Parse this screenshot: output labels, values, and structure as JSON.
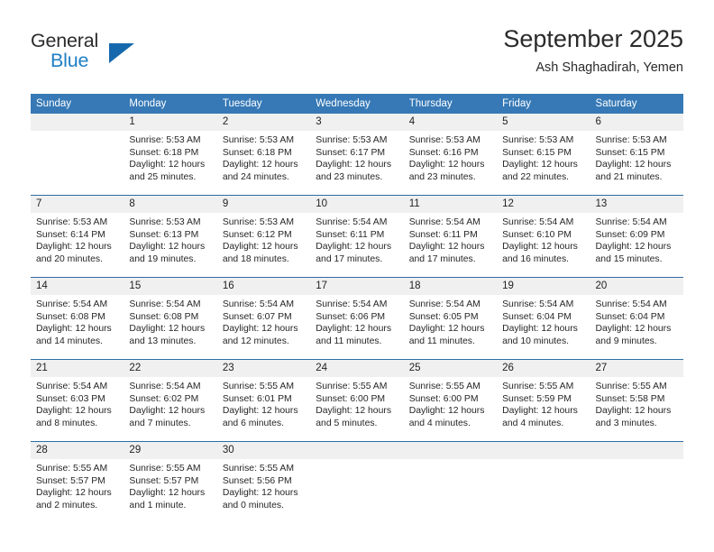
{
  "brand": {
    "word_one": "General",
    "word_two": "Blue",
    "triangle_icon": "triangle-icon",
    "accent_color": "#1668ad"
  },
  "header": {
    "title": "September 2025",
    "subtitle": "Ash Shaghadirah, Yemen"
  },
  "theme": {
    "header_row_bg": "#3679b6",
    "daynum_bg": "#f0f0f0",
    "week_separator": "#2e6da4",
    "text": "#262626"
  },
  "calendar": {
    "weekday_headers": [
      "Sunday",
      "Monday",
      "Tuesday",
      "Wednesday",
      "Thursday",
      "Friday",
      "Saturday"
    ],
    "weeks": [
      [
        {
          "day": "",
          "lines": []
        },
        {
          "day": "1",
          "lines": [
            "Sunrise: 5:53 AM",
            "Sunset: 6:18 PM",
            "Daylight: 12 hours",
            "and 25 minutes."
          ]
        },
        {
          "day": "2",
          "lines": [
            "Sunrise: 5:53 AM",
            "Sunset: 6:18 PM",
            "Daylight: 12 hours",
            "and 24 minutes."
          ]
        },
        {
          "day": "3",
          "lines": [
            "Sunrise: 5:53 AM",
            "Sunset: 6:17 PM",
            "Daylight: 12 hours",
            "and 23 minutes."
          ]
        },
        {
          "day": "4",
          "lines": [
            "Sunrise: 5:53 AM",
            "Sunset: 6:16 PM",
            "Daylight: 12 hours",
            "and 23 minutes."
          ]
        },
        {
          "day": "5",
          "lines": [
            "Sunrise: 5:53 AM",
            "Sunset: 6:15 PM",
            "Daylight: 12 hours",
            "and 22 minutes."
          ]
        },
        {
          "day": "6",
          "lines": [
            "Sunrise: 5:53 AM",
            "Sunset: 6:15 PM",
            "Daylight: 12 hours",
            "and 21 minutes."
          ]
        }
      ],
      [
        {
          "day": "7",
          "lines": [
            "Sunrise: 5:53 AM",
            "Sunset: 6:14 PM",
            "Daylight: 12 hours",
            "and 20 minutes."
          ]
        },
        {
          "day": "8",
          "lines": [
            "Sunrise: 5:53 AM",
            "Sunset: 6:13 PM",
            "Daylight: 12 hours",
            "and 19 minutes."
          ]
        },
        {
          "day": "9",
          "lines": [
            "Sunrise: 5:53 AM",
            "Sunset: 6:12 PM",
            "Daylight: 12 hours",
            "and 18 minutes."
          ]
        },
        {
          "day": "10",
          "lines": [
            "Sunrise: 5:54 AM",
            "Sunset: 6:11 PM",
            "Daylight: 12 hours",
            "and 17 minutes."
          ]
        },
        {
          "day": "11",
          "lines": [
            "Sunrise: 5:54 AM",
            "Sunset: 6:11 PM",
            "Daylight: 12 hours",
            "and 17 minutes."
          ]
        },
        {
          "day": "12",
          "lines": [
            "Sunrise: 5:54 AM",
            "Sunset: 6:10 PM",
            "Daylight: 12 hours",
            "and 16 minutes."
          ]
        },
        {
          "day": "13",
          "lines": [
            "Sunrise: 5:54 AM",
            "Sunset: 6:09 PM",
            "Daylight: 12 hours",
            "and 15 minutes."
          ]
        }
      ],
      [
        {
          "day": "14",
          "lines": [
            "Sunrise: 5:54 AM",
            "Sunset: 6:08 PM",
            "Daylight: 12 hours",
            "and 14 minutes."
          ]
        },
        {
          "day": "15",
          "lines": [
            "Sunrise: 5:54 AM",
            "Sunset: 6:08 PM",
            "Daylight: 12 hours",
            "and 13 minutes."
          ]
        },
        {
          "day": "16",
          "lines": [
            "Sunrise: 5:54 AM",
            "Sunset: 6:07 PM",
            "Daylight: 12 hours",
            "and 12 minutes."
          ]
        },
        {
          "day": "17",
          "lines": [
            "Sunrise: 5:54 AM",
            "Sunset: 6:06 PM",
            "Daylight: 12 hours",
            "and 11 minutes."
          ]
        },
        {
          "day": "18",
          "lines": [
            "Sunrise: 5:54 AM",
            "Sunset: 6:05 PM",
            "Daylight: 12 hours",
            "and 11 minutes."
          ]
        },
        {
          "day": "19",
          "lines": [
            "Sunrise: 5:54 AM",
            "Sunset: 6:04 PM",
            "Daylight: 12 hours",
            "and 10 minutes."
          ]
        },
        {
          "day": "20",
          "lines": [
            "Sunrise: 5:54 AM",
            "Sunset: 6:04 PM",
            "Daylight: 12 hours",
            "and 9 minutes."
          ]
        }
      ],
      [
        {
          "day": "21",
          "lines": [
            "Sunrise: 5:54 AM",
            "Sunset: 6:03 PM",
            "Daylight: 12 hours",
            "and 8 minutes."
          ]
        },
        {
          "day": "22",
          "lines": [
            "Sunrise: 5:54 AM",
            "Sunset: 6:02 PM",
            "Daylight: 12 hours",
            "and 7 minutes."
          ]
        },
        {
          "day": "23",
          "lines": [
            "Sunrise: 5:55 AM",
            "Sunset: 6:01 PM",
            "Daylight: 12 hours",
            "and 6 minutes."
          ]
        },
        {
          "day": "24",
          "lines": [
            "Sunrise: 5:55 AM",
            "Sunset: 6:00 PM",
            "Daylight: 12 hours",
            "and 5 minutes."
          ]
        },
        {
          "day": "25",
          "lines": [
            "Sunrise: 5:55 AM",
            "Sunset: 6:00 PM",
            "Daylight: 12 hours",
            "and 4 minutes."
          ]
        },
        {
          "day": "26",
          "lines": [
            "Sunrise: 5:55 AM",
            "Sunset: 5:59 PM",
            "Daylight: 12 hours",
            "and 4 minutes."
          ]
        },
        {
          "day": "27",
          "lines": [
            "Sunrise: 5:55 AM",
            "Sunset: 5:58 PM",
            "Daylight: 12 hours",
            "and 3 minutes."
          ]
        }
      ],
      [
        {
          "day": "28",
          "lines": [
            "Sunrise: 5:55 AM",
            "Sunset: 5:57 PM",
            "Daylight: 12 hours",
            "and 2 minutes."
          ]
        },
        {
          "day": "29",
          "lines": [
            "Sunrise: 5:55 AM",
            "Sunset: 5:57 PM",
            "Daylight: 12 hours",
            "and 1 minute."
          ]
        },
        {
          "day": "30",
          "lines": [
            "Sunrise: 5:55 AM",
            "Sunset: 5:56 PM",
            "Daylight: 12 hours",
            "and 0 minutes."
          ]
        },
        {
          "day": "",
          "lines": []
        },
        {
          "day": "",
          "lines": []
        },
        {
          "day": "",
          "lines": []
        },
        {
          "day": "",
          "lines": []
        }
      ]
    ]
  }
}
